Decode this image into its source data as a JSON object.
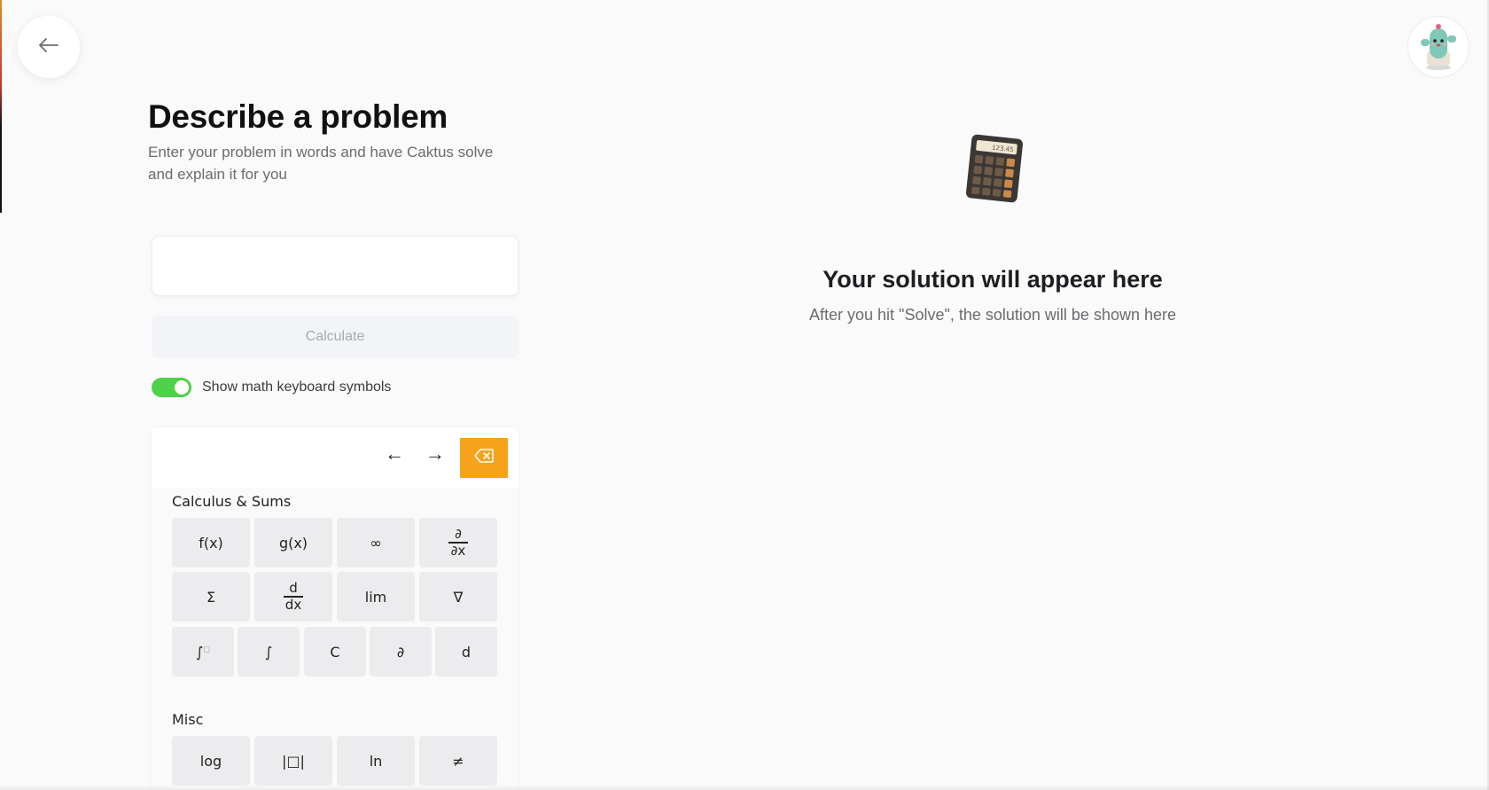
{
  "header": {
    "back_icon": "arrow-left-icon",
    "avatar_icon": "cactus-avatar-icon"
  },
  "left": {
    "title": "Describe a problem",
    "subtitle": "Enter your problem in words and have Caktus solve and explain it for you",
    "problem_input": {
      "value": "",
      "placeholder": ""
    },
    "calculate_label": "Calculate",
    "toggle": {
      "label": "Show math keyboard symbols",
      "on": true,
      "color": "#4fd14a"
    }
  },
  "keyboard": {
    "left_arrow": "←",
    "right_arrow": "→",
    "backspace_icon": "backspace-icon",
    "backspace_color": "#f6a21a",
    "sections": [
      {
        "title": "Calculus & Sums",
        "keys": [
          "f(x)",
          "g(x)",
          "∞",
          "∂/∂x",
          "Σ",
          "d/dx",
          "lim",
          "∇",
          "∫°",
          "∫",
          "C",
          "∂",
          "d"
        ]
      },
      {
        "title": "Misc",
        "keys": [
          "log",
          "|□|",
          "ln",
          "≠"
        ]
      }
    ],
    "calc": {
      "fx": "f(x)",
      "gx": "g(x)",
      "inf": "∞",
      "partial_dx_num": "∂",
      "partial_dx_den": "∂x",
      "sigma": "Σ",
      "d_dx_num": "d",
      "d_dx_den": "dx",
      "lim": "lim",
      "nabla": "∇",
      "int_def": "∫",
      "int_def_sup": "□",
      "int": "∫",
      "c": "C",
      "partial": "∂",
      "d": "d"
    },
    "misc": {
      "log": "log",
      "abs": "|□|",
      "ln": "ln",
      "neq": "≠"
    }
  },
  "right": {
    "icon": "calculator-icon",
    "calculator_display": "123.45",
    "title": "Your solution will appear here",
    "subtitle": "After you hit \"Solve\", the solution will be shown here"
  }
}
